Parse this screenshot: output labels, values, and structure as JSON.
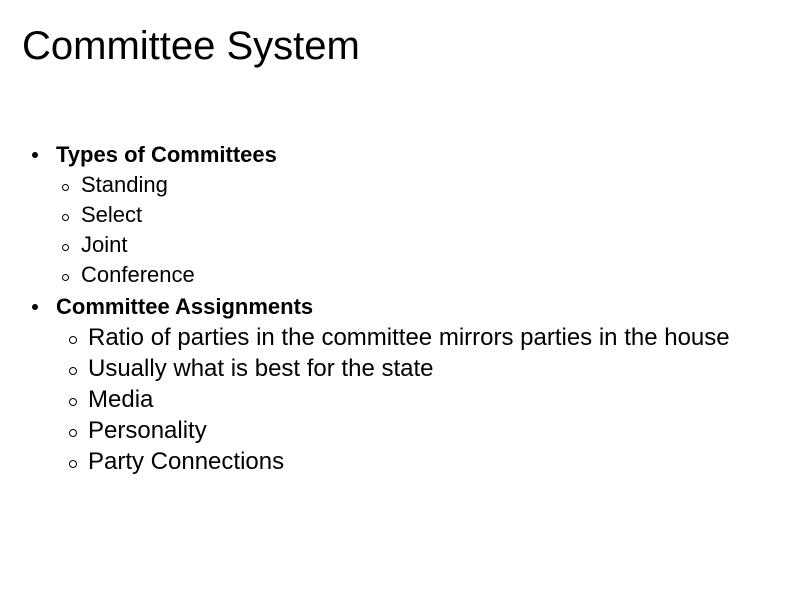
{
  "slide": {
    "title": "Committee System",
    "background_color": "#ffffff",
    "text_color": "#000000",
    "groups": [
      {
        "heading": "Types of Committees",
        "bullet_marker": "filled-dot",
        "sub_marker": "hollow-circle",
        "items": [
          "Standing",
          "Select",
          "Joint",
          "Conference"
        ]
      },
      {
        "heading": "Committee Assignments",
        "bullet_marker": "filled-dot",
        "sub_marker": "hollow-circle",
        "items": [
          "Ratio of parties in the committee mirrors parties in the house",
          "Usually what is best for the state",
          "Media",
          "Personality",
          "Party Connections"
        ]
      }
    ]
  }
}
